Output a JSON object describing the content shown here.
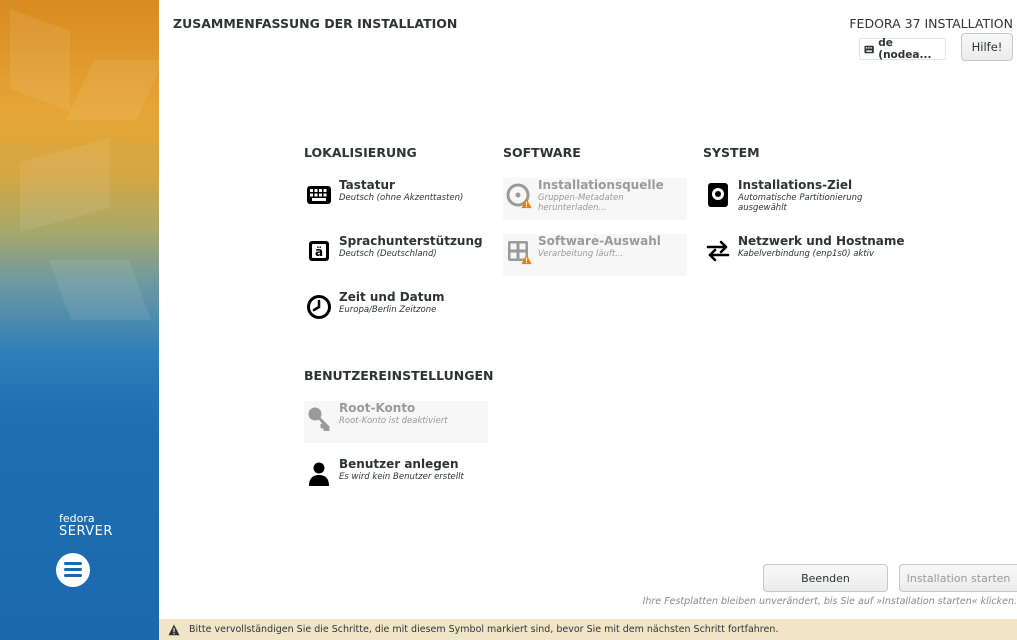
{
  "brand": {
    "line1": "fedora",
    "line2": "SERVER"
  },
  "header": {
    "page_title": "ZUSAMMENFASSUNG DER INSTALLATION",
    "product_title": "FEDORA 37 INSTALLATION",
    "keyboard_layout": "de (nodea...",
    "help_label": "Hilfe!"
  },
  "sections": {
    "localization": "LOKALISIERUNG",
    "software": "SOFTWARE",
    "system": "SYSTEM",
    "user_settings": "BENUTZEREINSTELLUNGEN"
  },
  "spokes": {
    "keyboard": {
      "title": "Tastatur",
      "status": "Deutsch (ohne Akzenttasten)",
      "icon": "keyboard-icon"
    },
    "language": {
      "title": "Sprachunterstützung",
      "status": "Deutsch (Deutschland)",
      "icon": "language-icon"
    },
    "datetime": {
      "title": "Zeit und Datum",
      "status": "Europa/Berlin Zeitzone",
      "icon": "clock-icon"
    },
    "source": {
      "title": "Installationsquelle",
      "status_line1": "Gruppen-Metadaten",
      "status_line2": "herunterladen...",
      "icon": "disc-icon"
    },
    "software_selection": {
      "title": "Software-Auswahl",
      "status": "Verarbeitung läuft...",
      "icon": "package-icon"
    },
    "destination": {
      "title": "Installations-Ziel",
      "status_line1": "Automatische Partitionierung",
      "status_line2": "ausgewählt",
      "icon": "harddisk-icon"
    },
    "network": {
      "title": "Netzwerk und Hostname",
      "status": "Kabelverbindung (enp1s0) aktiv",
      "icon": "network-arrows-icon"
    },
    "root": {
      "title": "Root-Konto",
      "status": "Root-Konto ist deaktiviert",
      "icon": "key-icon"
    },
    "user": {
      "title": "Benutzer anlegen",
      "status": "Es wird kein Benutzer erstellt",
      "icon": "user-icon"
    }
  },
  "footer": {
    "quit_label": "Beenden",
    "begin_label": "Installation starten",
    "disk_note": "Ihre Festplatten bleiben unverändert, bis Sie auf »Installation starten« klicken.",
    "warning_text": "Bitte vervollständigen Sie die Schritte, die mit diesem Symbol markiert sind, bevor Sie mit dem nächsten Schritt fortfahren."
  },
  "colors": {
    "accent_blue": "#1b68ae",
    "warning_bar": "#f1e5c8",
    "warning_icon": "#f57900",
    "disabled_text": "#9a9a9a"
  }
}
